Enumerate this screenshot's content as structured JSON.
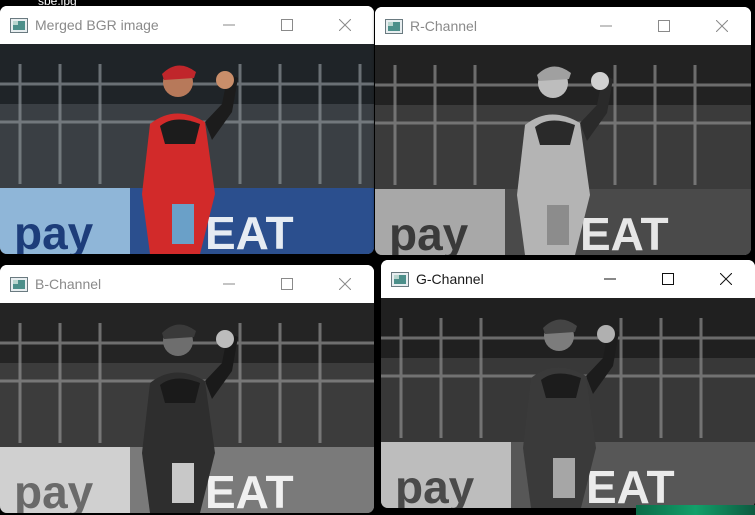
{
  "desktop": {
    "partial_label": "sbe.ipg"
  },
  "windows": [
    {
      "id": "merged",
      "title": "Merged BGR image",
      "active": false,
      "mode": "color"
    },
    {
      "id": "r",
      "title": "R-Channel",
      "active": false,
      "mode": "gray-light"
    },
    {
      "id": "b",
      "title": "B-Channel",
      "active": false,
      "mode": "gray-dark"
    },
    {
      "id": "g",
      "title": "G-Channel",
      "active": true,
      "mode": "gray-mid"
    }
  ],
  "image_text": {
    "banner_left": "pay",
    "banner_right": "EAT"
  },
  "icons": {
    "app": "image-window-icon",
    "minimize": "minimize-icon",
    "maximize": "maximize-icon",
    "close": "close-icon"
  }
}
